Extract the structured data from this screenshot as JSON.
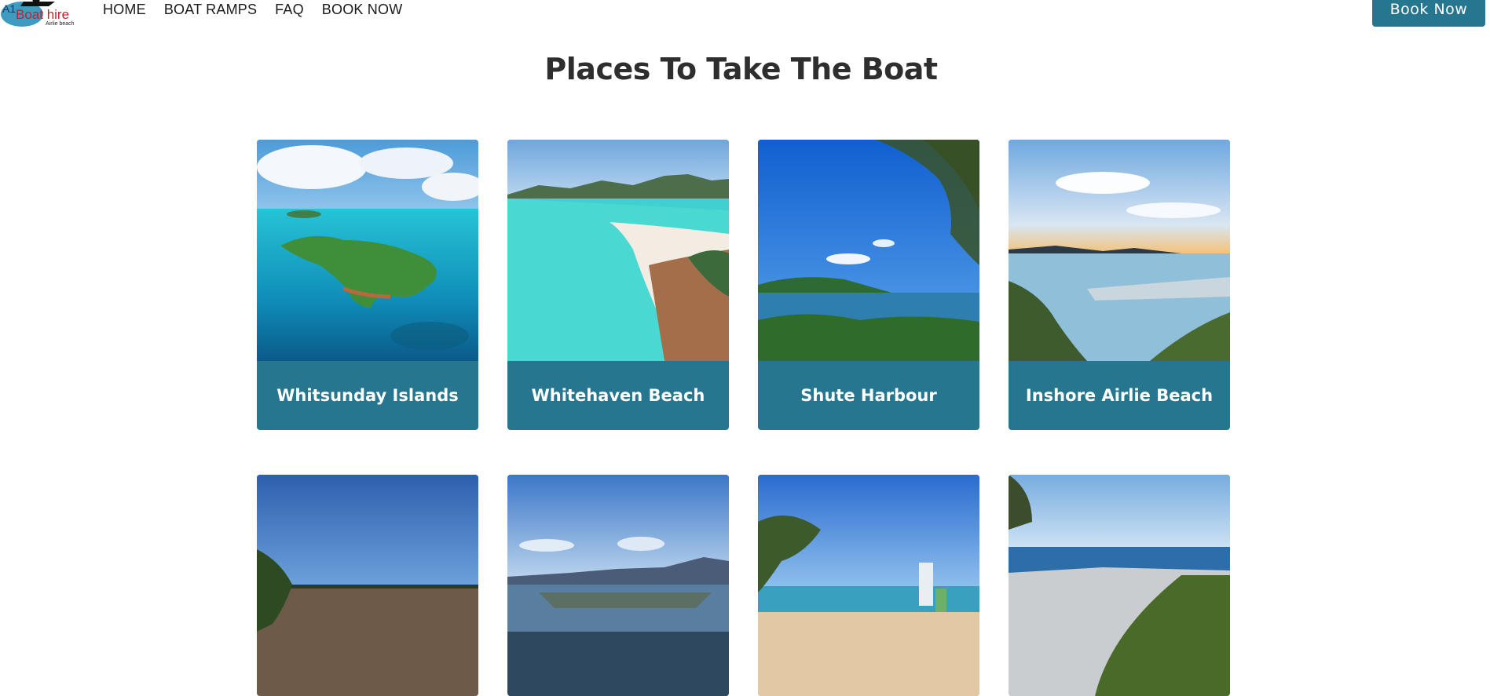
{
  "logo": {
    "text_top": "A1",
    "text_main": "Boat hire",
    "text_sub": "Airlie beach"
  },
  "nav": {
    "items": [
      "HOME",
      "BOAT RAMPS",
      "FAQ",
      "BOOK NOW"
    ]
  },
  "header": {
    "cta_label": "Book Now"
  },
  "main": {
    "title": "Places To Take The Boat",
    "row1": [
      {
        "label": "Whitsunday Islands"
      },
      {
        "label": "Whitehaven Beach"
      },
      {
        "label": "Shute Harbour"
      },
      {
        "label": "Inshore Airlie Beach"
      }
    ]
  },
  "colors": {
    "accent": "#27768f",
    "title": "#2e2e2e"
  }
}
